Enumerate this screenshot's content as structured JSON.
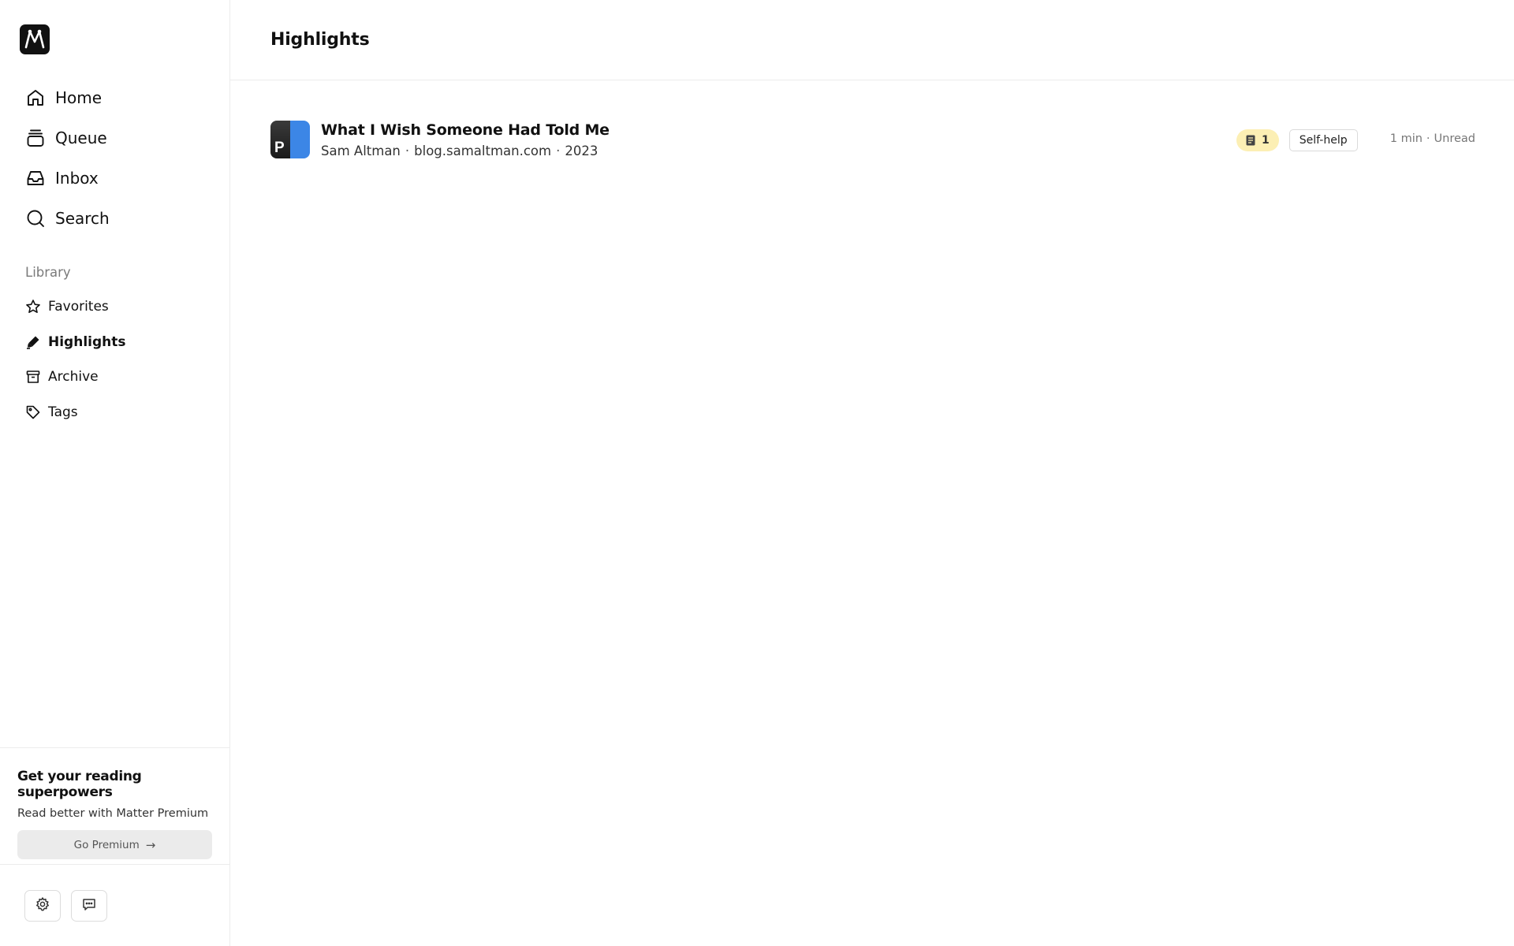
{
  "sidebar": {
    "logo_letter": "M",
    "nav": [
      {
        "label": "Home",
        "icon": "home-icon"
      },
      {
        "label": "Queue",
        "icon": "queue-icon"
      },
      {
        "label": "Inbox",
        "icon": "inbox-icon"
      },
      {
        "label": "Search",
        "icon": "search-icon"
      }
    ],
    "library_title": "Library",
    "library": [
      {
        "label": "Favorites",
        "icon": "star-icon"
      },
      {
        "label": "Highlights",
        "icon": "highlighter-icon",
        "active": true
      },
      {
        "label": "Archive",
        "icon": "archive-icon"
      },
      {
        "label": "Tags",
        "icon": "tag-icon"
      }
    ],
    "promo": {
      "title": "Get your reading superpowers",
      "subtitle": "Read better with Matter Premium",
      "button_label": "Go Premium",
      "button_arrow": "→"
    },
    "footer": {
      "settings_icon": "gear-icon",
      "feedback_icon": "chat-icon"
    }
  },
  "main": {
    "title": "Highlights",
    "articles": [
      {
        "thumb_letter": "P",
        "title": "What I Wish Someone Had Told Me",
        "author": "Sam Altman",
        "source": "blog.samaltman.com",
        "year": "2023",
        "highlight_count": "1",
        "tag": "Self-help",
        "read_time": "1 min",
        "status": "Unread"
      }
    ],
    "separator": "·"
  },
  "colors": {
    "highlight_badge_bg": "#fcefb4",
    "thumb_blue": "#3c86e6",
    "logo_bg": "#111111"
  }
}
